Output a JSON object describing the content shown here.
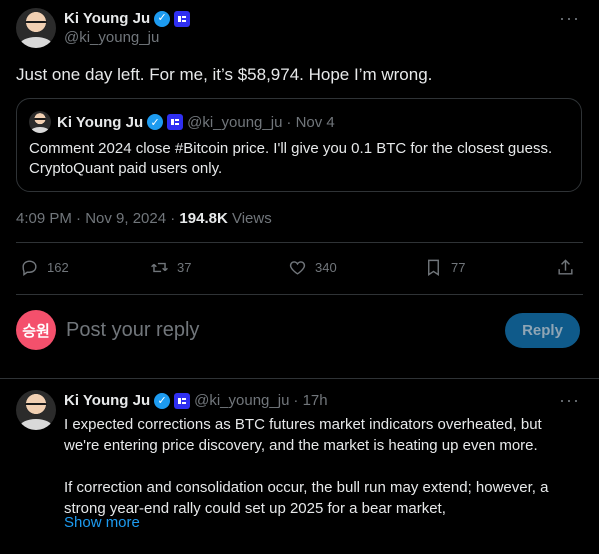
{
  "main_tweet": {
    "name": "Ki Young Ju",
    "handle": "@ki_young_ju",
    "text": "Just one day left. For me, it’s $58,974. Hope I’m wrong.",
    "more_label": "···",
    "quote": {
      "name": "Ki Young Ju",
      "handle": "@ki_young_ju",
      "date": "· Nov 4",
      "line1": "Comment 2024 close #Bitcoin price. I'll give you 0.1 BTC for the closest guess.",
      "line2": "CryptoQuant paid users only."
    },
    "timestamp": "4:09 PM · Nov 9, 2024 · ",
    "views_count": "194.8K",
    "views_label": "Views",
    "actions": {
      "replies": "162",
      "retweets": "37",
      "likes": "340",
      "bookmarks": "77"
    }
  },
  "reply_composer": {
    "avatar_text": "승원",
    "placeholder": "Post your reply",
    "button_label": "Reply"
  },
  "reply_tweet": {
    "name": "Ki Young Ju",
    "handle": "@ki_young_ju",
    "time": "· 17h",
    "para1": "I expected corrections as BTC futures market indicators overheated, but we're entering price discovery, and the market is heating up even more.",
    "para2": "If correction and consolidation occur, the bull run may extend; however, a strong year-end rally could set up 2025 for a bear market,",
    "show_more": "Show more",
    "more_label": "···"
  },
  "colors": {
    "background": "#000000",
    "text": "#e7e9ea",
    "muted": "#71767b",
    "accent": "#1d9bf0",
    "border": "#2f3336",
    "reply_button": "#0f5a8a",
    "composer_avatar": "#f4506c"
  }
}
